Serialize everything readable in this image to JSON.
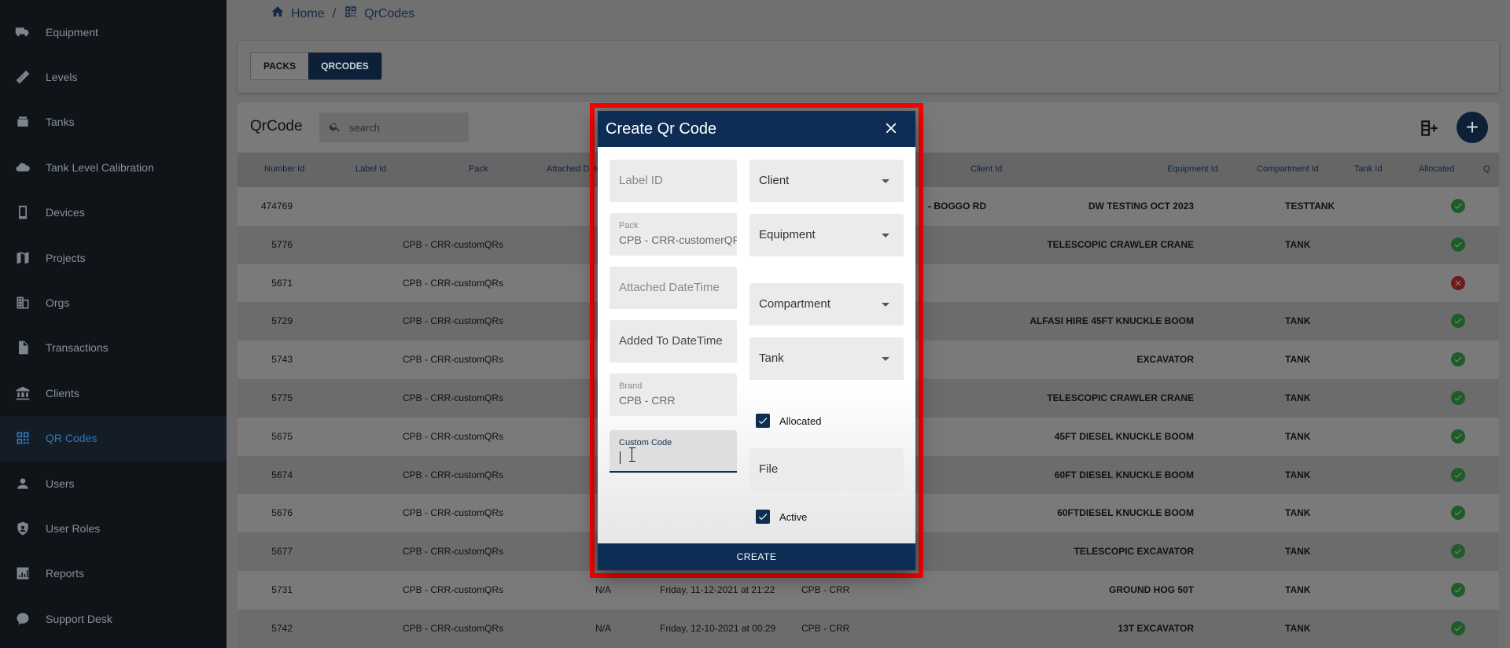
{
  "sidebar": {
    "items": [
      {
        "label": "Equipment",
        "icon": "truck-icon"
      },
      {
        "label": "Levels",
        "icon": "ruler-icon"
      },
      {
        "label": "Tanks",
        "icon": "tank-icon"
      },
      {
        "label": "Tank Level Calibration",
        "icon": "cloud-icon"
      },
      {
        "label": "Devices",
        "icon": "device-icon"
      },
      {
        "label": "Projects",
        "icon": "map-icon"
      },
      {
        "label": "Orgs",
        "icon": "building-icon"
      },
      {
        "label": "Transactions",
        "icon": "document-icon"
      },
      {
        "label": "Clients",
        "icon": "bank-icon"
      },
      {
        "label": "QR Codes",
        "icon": "qr-icon",
        "active": true
      },
      {
        "label": "Users",
        "icon": "person-icon"
      },
      {
        "label": "User Roles",
        "icon": "shield-icon"
      },
      {
        "label": "Reports",
        "icon": "chart-icon"
      },
      {
        "label": "Support Desk",
        "icon": "support-icon"
      }
    ]
  },
  "breadcrumb": {
    "home": "Home",
    "separator": "/",
    "current": "QrCodes"
  },
  "toggle": {
    "packs": "PACKS",
    "qrcodes": "QRCODES"
  },
  "table": {
    "title": "QrCode",
    "search_placeholder": "search",
    "headers": [
      "Number Id",
      "Label Id",
      "Pack",
      "Attached Date",
      "Client Id",
      "Equipment Id",
      "Compartment Id",
      "Tank Id",
      "Allocated",
      "Q"
    ],
    "rows": [
      {
        "number_id": "474769",
        "pack": "",
        "attached": "",
        "added": "",
        "brand": "",
        "client": "- BOGGO RD",
        "equipment": "DW TESTING OCT 2023",
        "compartment": "TESTTANK",
        "allocated": true
      },
      {
        "number_id": "5776",
        "pack": "CPB - CRR-customQRs",
        "attached": "",
        "added": "",
        "brand": "",
        "client": "",
        "equipment": "TELESCOPIC CRAWLER CRANE",
        "compartment": "TANK",
        "allocated": true
      },
      {
        "number_id": "5671",
        "pack": "CPB - CRR-customQRs",
        "attached": "",
        "added": "",
        "brand": "",
        "client": "",
        "equipment": "",
        "compartment": "",
        "allocated": false
      },
      {
        "number_id": "5729",
        "pack": "CPB - CRR-customQRs",
        "attached": "",
        "added": "",
        "brand": "",
        "client": "",
        "equipment": "ALFASI HIRE 45FT KNUCKLE BOOM",
        "compartment": "TANK",
        "allocated": true
      },
      {
        "number_id": "5743",
        "pack": "CPB - CRR-customQRs",
        "attached": "",
        "added": "",
        "brand": "",
        "client": "",
        "equipment": "EXCAVATOR",
        "compartment": "TANK",
        "allocated": true
      },
      {
        "number_id": "5775",
        "pack": "CPB - CRR-customQRs",
        "attached": "",
        "added": "",
        "brand": "",
        "client": "",
        "equipment": "TELESCOPIC CRAWLER CRANE",
        "compartment": "TANK",
        "allocated": true
      },
      {
        "number_id": "5675",
        "pack": "CPB - CRR-customQRs",
        "attached": "",
        "added": "",
        "brand": "",
        "client": "",
        "equipment": "45FT DIESEL KNUCKLE BOOM",
        "compartment": "TANK",
        "allocated": true
      },
      {
        "number_id": "5674",
        "pack": "CPB - CRR-customQRs",
        "attached": "",
        "added": "",
        "brand": "",
        "client": "",
        "equipment": "60FT DIESEL KNUCKLE BOOM",
        "compartment": "TANK",
        "allocated": true
      },
      {
        "number_id": "5676",
        "pack": "CPB - CRR-customQRs",
        "attached": "",
        "added": "",
        "brand": "",
        "client": "",
        "equipment": "60FTDIESEL KNUCKLE BOOM",
        "compartment": "TANK",
        "allocated": true
      },
      {
        "number_id": "5677",
        "pack": "CPB - CRR-customQRs",
        "attached": "",
        "added": "",
        "brand": "",
        "client": "",
        "equipment": "TELESCOPIC EXCAVATOR",
        "compartment": "TANK",
        "allocated": true
      },
      {
        "number_id": "5731",
        "pack": "CPB - CRR-customQRs",
        "attached": "N/A",
        "added": "Friday, 11-12-2021 at 21:22",
        "brand": "CPB - CRR",
        "client": "",
        "equipment": "GROUND HOG 50T",
        "compartment": "TANK",
        "allocated": true
      },
      {
        "number_id": "5742",
        "pack": "CPB - CRR-customQRs",
        "attached": "N/A",
        "added": "Friday, 12-10-2021 at 00:29",
        "brand": "CPB - CRR",
        "client": "",
        "equipment": "13T EXCAVATOR",
        "compartment": "TANK",
        "allocated": true
      }
    ]
  },
  "modal": {
    "title": "Create Qr Code",
    "label_id_placeholder": "Label ID",
    "client_placeholder": "Client",
    "pack_label": "Pack",
    "pack_value": "CPB - CRR-customerQR",
    "equipment_placeholder": "Equipment",
    "attached_placeholder": "Attached DateTime",
    "compartment_placeholder": "Compartment",
    "added_placeholder": "Added To DateTime",
    "tank_placeholder": "Tank",
    "brand_label": "Brand",
    "brand_value": "CPB - CRR",
    "allocated_label": "Allocated",
    "allocated_checked": true,
    "custom_code_label": "Custom Code",
    "custom_code_value": "",
    "file_placeholder": "File",
    "active_label": "Active",
    "active_checked": true,
    "create_label": "CREATE"
  },
  "colors": {
    "primary": "#0d2d54",
    "highlight": "#ff0000",
    "sidebar": "#0f1419",
    "active_nav": "#2e78b8"
  }
}
